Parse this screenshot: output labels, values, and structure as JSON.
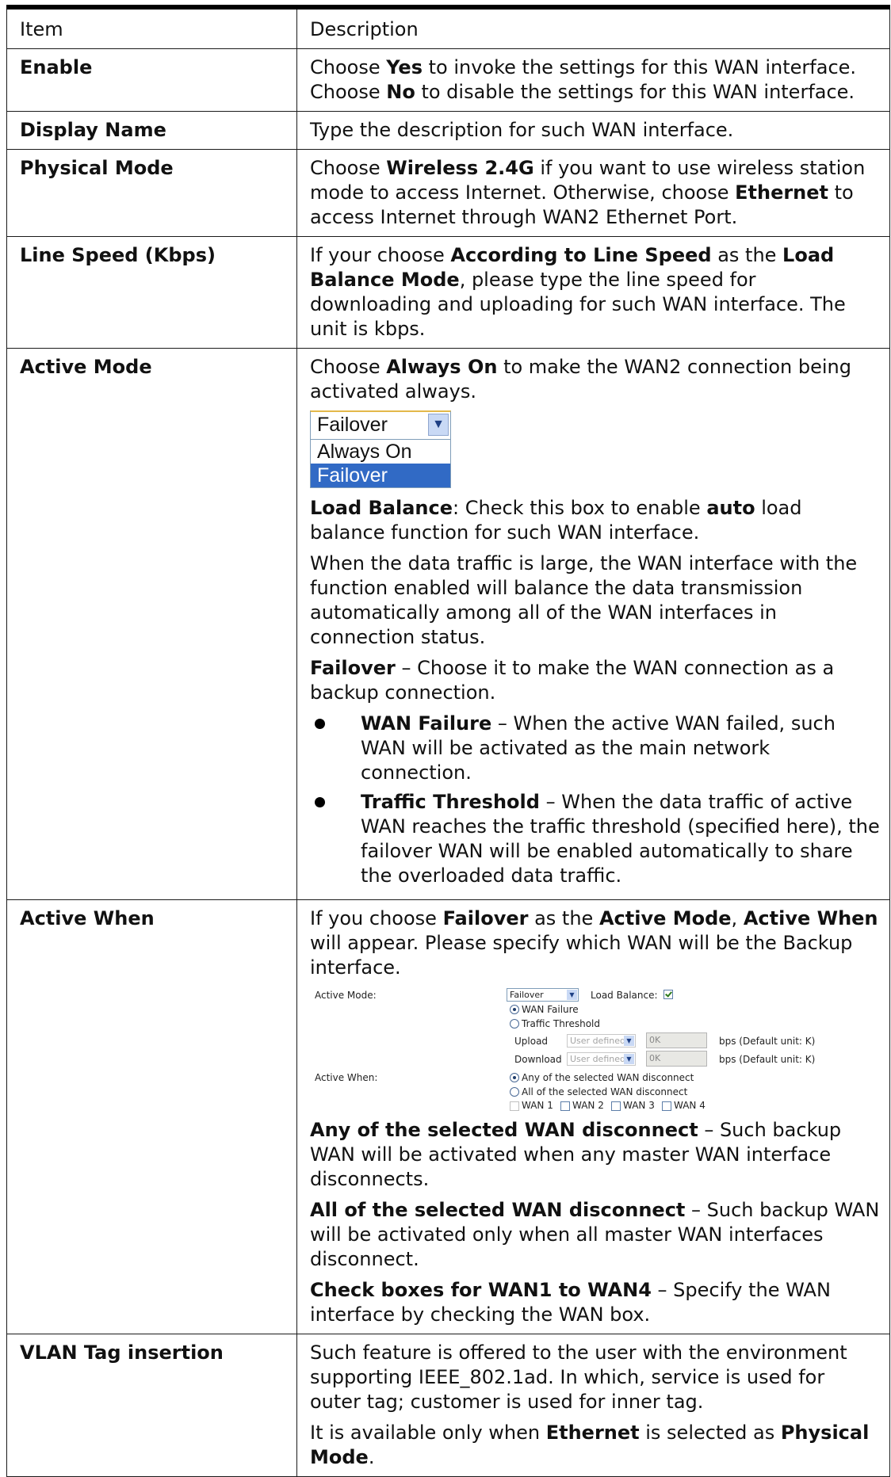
{
  "table": {
    "headers": [
      "Item",
      "Description"
    ]
  },
  "rows": {
    "enable": {
      "item": "Enable",
      "line1_pre": "Choose ",
      "line1_bold": "Yes",
      "line1_post": " to invoke the settings for this WAN interface.",
      "line2_pre": "Choose ",
      "line2_bold": "No",
      "line2_post": " to disable the settings for this WAN interface."
    },
    "display_name": {
      "item": "Display Name",
      "desc": "Type the description for such WAN interface."
    },
    "physical_mode": {
      "item": "Physical Mode",
      "pre": "Choose ",
      "b1": "Wireless 2.4G",
      "mid": " if you want to use wireless station mode to access Internet. Otherwise, choose ",
      "b2": "Ethernet",
      "post": " to access Internet through WAN2 Ethernet Port."
    },
    "line_speed": {
      "item": "Line Speed (Kbps)",
      "pre": "If your choose ",
      "b1": "According to Line Speed",
      "mid1": " as the ",
      "b2": "Load Balance Mode",
      "post": ", please type the line speed for downloading and uploading for such WAN interface. The unit is kbps."
    },
    "active_mode": {
      "item": "Active Mode",
      "p1_pre": "Choose ",
      "p1_bold": "Always On",
      "p1_post": " to make the WAN2 connection being activated always.",
      "dropdown": {
        "selected": "Failover",
        "options": [
          "Always On",
          "Failover"
        ]
      },
      "p2_bold1": "Load Balance",
      "p2_mid": ": Check this box to enable ",
      "p2_bold2": "auto",
      "p2_post": " load balance function for such WAN interface.",
      "p3": "When the data traffic is large, the WAN interface with the function enabled will balance the data transmission automatically among all of the WAN interfaces in connection status.",
      "p4_bold": "Failover",
      "p4_post": " – Choose it to make the WAN connection as a backup connection.",
      "bullets": [
        {
          "bold": "WAN Failure",
          "text": " – When the active WAN failed, such WAN will be activated as the main network connection."
        },
        {
          "bold": "Traffic Threshold",
          "text": " – When the data traffic of active WAN reaches the traffic threshold (specified here), the failover WAN will be enabled automatically to share the overloaded data traffic."
        }
      ]
    },
    "active_when": {
      "item": "Active When",
      "p1_pre": "If you choose ",
      "p1_b1": "Failover",
      "p1_mid1": " as the ",
      "p1_b2": "Active Mode",
      "p1_mid2": ", ",
      "p1_b3": "Active When",
      "p1_post": " will appear. Please specify which WAN will be the Backup interface.",
      "mini": {
        "active_mode_label": "Active Mode:",
        "active_mode_value": "Failover",
        "load_balance_label": "Load Balance:",
        "wan_failure": "WAN Failure",
        "traffic_threshold": "Traffic Threshold",
        "upload_label": "Upload",
        "download_label": "Download",
        "user_defined": "User defined",
        "zero_k": "0K",
        "bps_note": "bps (Default unit: K)",
        "active_when_label": "Active When:",
        "any_option": "Any of the selected WAN disconnect",
        "all_option": "All of the selected WAN disconnect",
        "wan1": "WAN 1",
        "wan2": "WAN 2",
        "wan3": "WAN 3",
        "wan4": "WAN 4"
      },
      "p2_bold": "Any of the selected WAN disconnect",
      "p2_post": " – Such backup WAN will be activated when any master WAN interface disconnects.",
      "p3_bold": "All of the selected WAN disconnect",
      "p3_post": " – Such backup WAN will be activated only when all master WAN interfaces disconnect.",
      "p4_bold": "Check boxes for WAN1 to WAN4",
      "p4_post": " – Specify the WAN interface by checking the WAN box."
    },
    "vlan": {
      "item": "VLAN Tag insertion",
      "p1": "Such feature is offered to the user with the environment supporting IEEE_802.1ad. In which, service is used for outer tag; customer is used for inner tag.",
      "p2_pre": "It is available only when ",
      "p2_b1": "Ethernet",
      "p2_mid": " is selected as ",
      "p2_b2": "Physical Mode",
      "p2_post": "."
    }
  }
}
